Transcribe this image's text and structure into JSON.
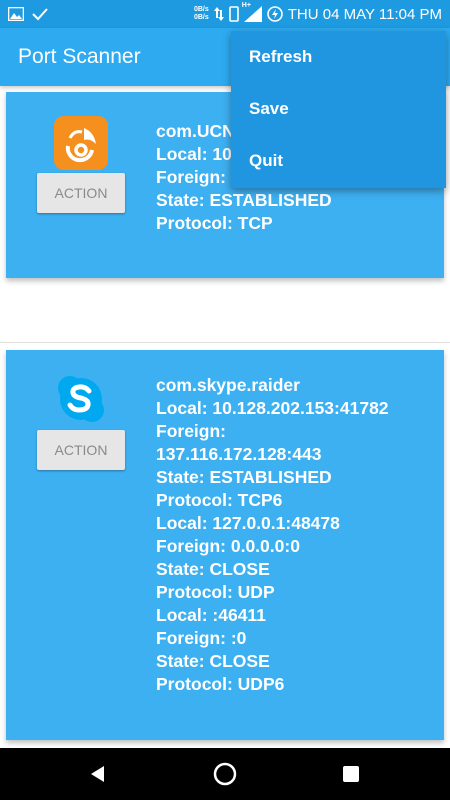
{
  "status_bar": {
    "speed_top": "0B/s",
    "speed_bottom": "0B/s",
    "network_label": "H+",
    "datetime": "THU 04 MAY 11:04 PM"
  },
  "app_bar": {
    "title": "Port Scanner"
  },
  "menu": {
    "items": [
      {
        "label": "Refresh"
      },
      {
        "label": "Save"
      },
      {
        "label": "Quit"
      }
    ]
  },
  "cards": [
    {
      "package": "com.UCM",
      "icon": "uc-browser-icon",
      "action_label": "ACTION",
      "lines": [
        "com.UCN",
        "Local: 10",
        "Foreign:",
        "State: ESTABLISHED",
        "Protocol: TCP"
      ]
    },
    {
      "package": "com.skype.raider",
      "icon": "skype-icon",
      "action_label": "ACTION",
      "lines": [
        "com.skype.raider",
        "Local: 10.128.202.153:41782",
        "Foreign:",
        "137.116.172.128:443",
        "State: ESTABLISHED",
        "Protocol: TCP6",
        "Local: 127.0.0.1:48478",
        "Foreign: 0.0.0.0:0",
        "State: CLOSE",
        "Protocol: UDP",
        "Local: :46411",
        "Foreign: :0",
        "State: CLOSE",
        "Protocol: UDP6"
      ]
    }
  ],
  "colors": {
    "status_bar": "#1E9BE0",
    "app_bar": "#2DAAF0",
    "card": "#3DB0F2",
    "menu": "#2196E0",
    "uc_orange": "#F5901E",
    "skype_blue": "#00A8F0"
  }
}
